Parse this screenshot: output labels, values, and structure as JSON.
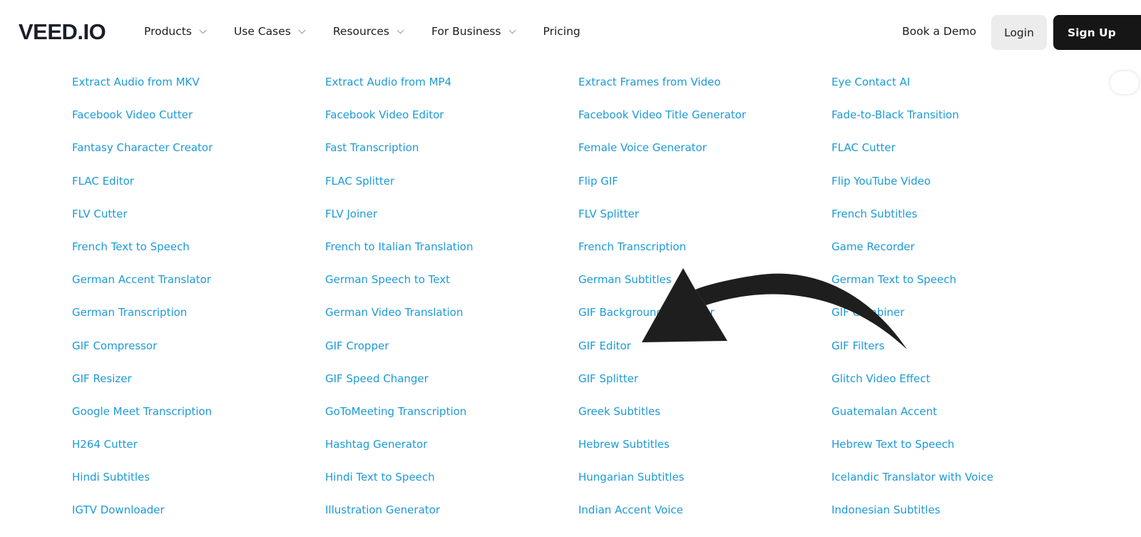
{
  "header": {
    "logo": "VEED.IO",
    "nav": [
      "Products",
      "Use Cases",
      "Resources",
      "For Business"
    ],
    "pricing": "Pricing",
    "book_demo": "Book a Demo",
    "login": "Login",
    "signup": "Sign Up"
  },
  "links": [
    "Extract Audio from MKV",
    "Extract Audio from MP4",
    "Extract Frames from Video",
    "Eye Contact AI",
    "Facebook Video Cutter",
    "Facebook Video Editor",
    "Facebook Video Title Generator",
    "Fade-to-Black Transition",
    "Fantasy Character Creator",
    "Fast Transcription",
    "Female Voice Generator",
    "FLAC Cutter",
    "FLAC Editor",
    "FLAC Splitter",
    "Flip GIF",
    "Flip YouTube Video",
    "FLV Cutter",
    "FLV Joiner",
    "FLV Splitter",
    "French Subtitles",
    "French Text to Speech",
    "French to Italian Translation",
    "French Transcription",
    "Game Recorder",
    "German Accent Translator",
    "German Speech to Text",
    "German Subtitles",
    "German Text to Speech",
    "German Transcription",
    "German Video Translation",
    "GIF Background Remover",
    "GIF Combiner",
    "GIF Compressor",
    "GIF Cropper",
    "GIF Editor",
    "GIF Filters",
    "GIF Resizer",
    "GIF Speed Changer",
    "GIF Splitter",
    "Glitch Video Effect",
    "Google Meet Transcription",
    "GoToMeeting Transcription",
    "Greek Subtitles",
    "Guatemalan Accent",
    "H264 Cutter",
    "Hashtag Generator",
    "Hebrew Subtitles",
    "Hebrew Text to Speech",
    "Hindi Subtitles",
    "Hindi Text to Speech",
    "Hungarian Subtitles",
    "Icelandic Translator with Voice",
    "IGTV Downloader",
    "Illustration Generator",
    "Indian Accent Voice",
    "Indonesian Subtitles"
  ],
  "colors": {
    "link": "#1d9ad6",
    "arrow": "#1e1e1e",
    "signup_bg": "#161616",
    "login_bg": "#ececec"
  }
}
